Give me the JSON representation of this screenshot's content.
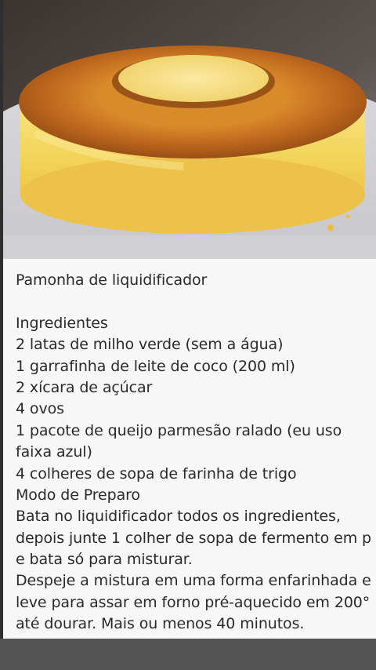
{
  "photo": {
    "subject": "pamonha-cake-photo"
  },
  "recipe": {
    "title": "Pamonha de liquidificador",
    "ingredients_heading": "Ingredientes",
    "ingredients": [
      "2 latas de milho verde (sem a água)",
      "1 garrafinha de leite de coco (200 ml)",
      "2 xícara de açúcar",
      "4 ovos",
      "1 pacote de queijo parmesão ralado (eu uso",
      "faixa azul)",
      "4 colheres de sopa de farinha de trigo"
    ],
    "method_heading": "Modo de Preparo",
    "method_lines": [
      "Bata no liquidificador todos os ingredientes,",
      "depois junte 1 colher de sopa de fermento em p",
      "e bata só para misturar.",
      "Despeje a mistura em uma forma enfarinhada e",
      "leve para assar em forno pré-aquecido em 200°",
      "até dourar. Mais ou menos 40 minutos."
    ]
  },
  "colors": {
    "card_background": "#f7f7f7",
    "text": "#2a2a2a",
    "cake_crust": "#b9651b",
    "cake_body": "#f3d35c"
  }
}
